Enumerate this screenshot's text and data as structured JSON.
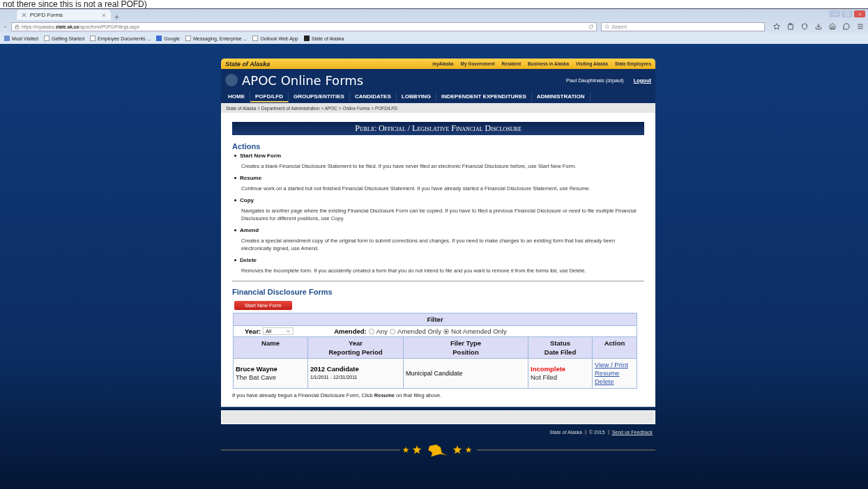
{
  "caption": "not there since this is not a real POFD)",
  "browser": {
    "tab_title": "POFD Forms",
    "url_host": "https://myalaska.",
    "url_domain": "state.ak.us",
    "url_path": "/apoc/form/POFD/Filings.aspx",
    "search_placeholder": "Search",
    "bookmarks": [
      {
        "label": "Most Visited",
        "kind": "star"
      },
      {
        "label": "Getting Started",
        "kind": "page"
      },
      {
        "label": "Employee Documents ...",
        "kind": "page"
      },
      {
        "label": "Google",
        "kind": "google"
      },
      {
        "label": "Messaging, Enterprise ...",
        "kind": "page"
      },
      {
        "label": "Outlook Web App",
        "kind": "page"
      },
      {
        "label": "State of Alaska",
        "kind": "seal"
      }
    ]
  },
  "state_bar": {
    "brand": "State of Alaska",
    "links": [
      "myAlaska",
      "My Government",
      "Resident",
      "Business in Alaska",
      "Visiting Alaska",
      "State Employees"
    ]
  },
  "header": {
    "title": "APOC Online Forms",
    "user": "Paul Dauphinais (drpaul)",
    "logout": "Logout"
  },
  "nav": [
    {
      "label": "HOME",
      "selected": false
    },
    {
      "label": "POFD/LFD",
      "selected": true
    },
    {
      "label": "GROUPS/ENTITIES",
      "selected": false
    },
    {
      "label": "CANDIDATES",
      "selected": false
    },
    {
      "label": "LOBBYING",
      "selected": false
    },
    {
      "label": "INDEPENDENT EXPENDITURES",
      "selected": false
    },
    {
      "label": "ADMINISTRATION",
      "selected": false
    }
  ],
  "breadcrumb": "State of Alaska > Department of Administration > APOC > Online Forms > POFD/LFD",
  "banner": "Public Official / Legislative Financial Disclosure",
  "actions": {
    "heading": "Actions",
    "items": [
      {
        "title": "Start New Form",
        "description": "Creates a blank Financial Disclosure Statement to be filed. If you have never filed an electronic Financial Disclosure before, use Start New Form."
      },
      {
        "title": "Resume",
        "description": "Continue work on a started but not finished Financial Disclosure Statement. If you have already started a Financial Disclosure Statement, use Resume."
      },
      {
        "title": "Copy",
        "description": "Navigates to another page where the existing Financial Disclosure Form can be copied. If you have to filed a previous Financial Disclosure or need to file multiple Financial Disclosures for different positions, use Copy."
      },
      {
        "title": "Amend",
        "description": "Creates a special amendment copy of the original form to submit corrections and changes. If you need to make changes to an existing form that has already been electronically signed, use Amend."
      },
      {
        "title": "Delete",
        "description": "Removes the Incomplete form. If you accidently created a form that you do not intend to file and you want to remove it from the forms list, use Delete."
      }
    ]
  },
  "forms": {
    "heading": "Financial Disclosure Forms",
    "start_button": "Start New Form",
    "filter": {
      "title": "Filter",
      "year_label": "Year:",
      "year_value": "All",
      "amended_label": "Amended:",
      "options": [
        {
          "label": "Any",
          "selected": false
        },
        {
          "label": "Amended Only",
          "selected": false
        },
        {
          "label": "Not Amended Only",
          "selected": true
        }
      ]
    },
    "columns": [
      [
        "Name"
      ],
      [
        "Year",
        "Reporting Period"
      ],
      [
        "Filer Type",
        "Position"
      ],
      [
        "Status",
        "Date Filed"
      ],
      [
        "Action"
      ]
    ],
    "rows": [
      {
        "name": "Bruce  Wayne",
        "location": "The Bat Cave",
        "year": "2012 Candidate",
        "period": "1/1/2011 - 12/31/2011",
        "filer_type": "Municipal Candidate",
        "status": "Incomplete",
        "date_filed": "Not Filed",
        "links": [
          "View / Print",
          "Resume",
          "Delete"
        ]
      }
    ],
    "note": "If you have already begun a Financial Disclosure Form, Click **Resume** on that filing above."
  },
  "footer": {
    "links": [
      {
        "label": "State of Alaska",
        "kind": "text"
      },
      {
        "label": "© 2015",
        "kind": "text"
      },
      {
        "label": "Send us Feedback",
        "kind": "link"
      }
    ]
  }
}
